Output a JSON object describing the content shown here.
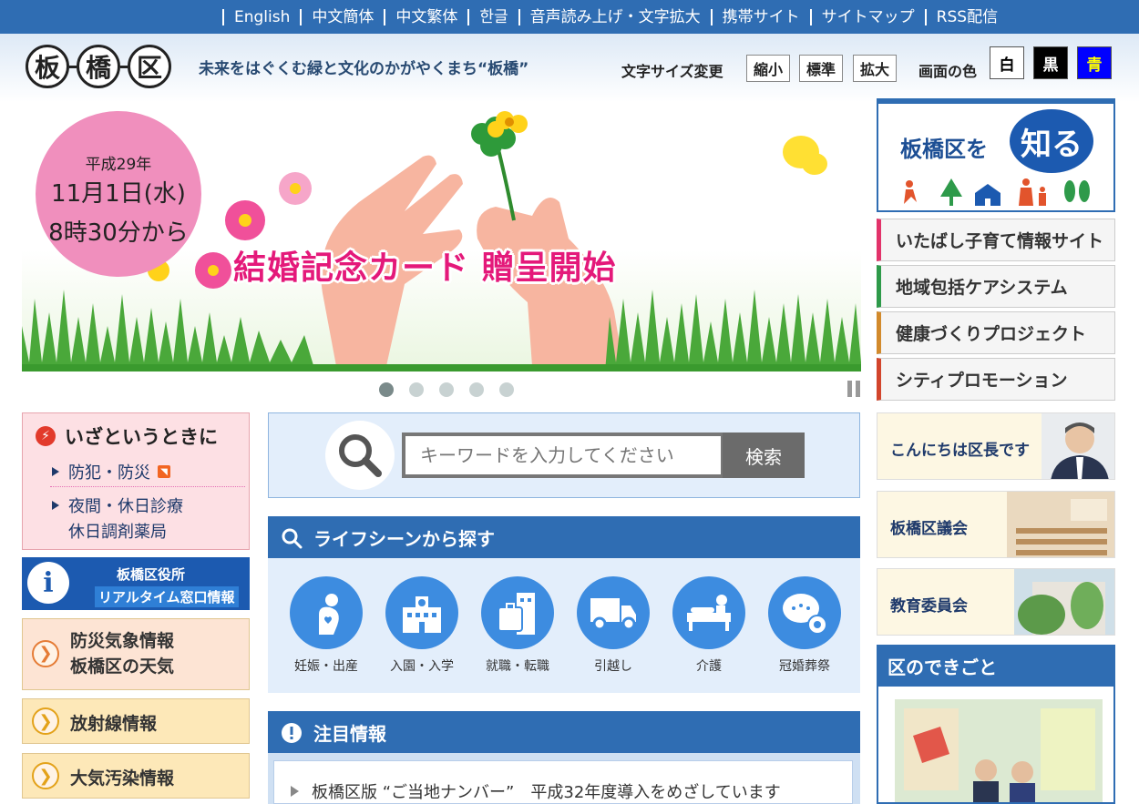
{
  "topbar": {
    "links": [
      "English",
      "中文簡体",
      "中文繁体",
      "한글",
      "音声読み上げ・文字拡大",
      "携帯サイト",
      "サイトマップ",
      "RSS配信"
    ]
  },
  "header": {
    "logo_chars": [
      "板",
      "橋",
      "区"
    ],
    "tagline": "未来をはぐくむ緑と文化のかがやくまち“板橋”",
    "font_size_label": "文字サイズ変更",
    "font_size_buttons": [
      "縮小",
      "標準",
      "拡大"
    ],
    "color_label": "画面の色",
    "color_buttons": [
      {
        "label": "白",
        "bg": "#ffffff",
        "fg": "#000000"
      },
      {
        "label": "黒",
        "bg": "#000000",
        "fg": "#ffffff"
      },
      {
        "label": "青",
        "bg": "#0000ff",
        "fg": "#ffff00"
      }
    ]
  },
  "hero": {
    "date_line1": "平成29年",
    "date_line2": "11月1日(水)",
    "date_line3": "8時30分から",
    "title": "結婚記念カード 贈呈開始",
    "slide_count": 5,
    "active_slide": 1
  },
  "right": {
    "know_text": "板橋区を",
    "know_highlight": "知る",
    "links": [
      {
        "label": "いたばし子育て情報サイト",
        "accent": "#e2336a"
      },
      {
        "label": "地域包括ケアシステム",
        "accent": "#2e9a4a"
      },
      {
        "label": "健康づくりプロジェクト",
        "accent": "#d28a2c"
      },
      {
        "label": "シティプロモーション",
        "accent": "#d2452c"
      }
    ],
    "cards": [
      "こんにちは区長です",
      "板橋区議会",
      "教育委員会"
    ],
    "events_title": "区のできごと"
  },
  "left": {
    "emergency_title": "いざというときに",
    "emergency_items": [
      "防犯・防災",
      "夜間・休日診療",
      "休日調剤薬局"
    ],
    "realtime_line1": "板橋区役所",
    "realtime_line2": "リアルタイム窓口情報",
    "boxes": [
      {
        "line1": "防災気象情報",
        "line2": "板橋区の天気"
      },
      {
        "line1": "放射線情報"
      },
      {
        "line1": "大気汚染情報"
      }
    ]
  },
  "search": {
    "placeholder": "キーワードを入力してください",
    "button": "検索"
  },
  "lifescene": {
    "title": "ライフシーンから探す",
    "items": [
      "妊娠・出産",
      "入園・入学",
      "就職・転職",
      "引越し",
      "介護",
      "冠婚葬祭"
    ]
  },
  "notice": {
    "title": "注目情報",
    "items": [
      "板橋区版 “ご当地ナンバー”　平成32年度導入をめざしています"
    ]
  }
}
